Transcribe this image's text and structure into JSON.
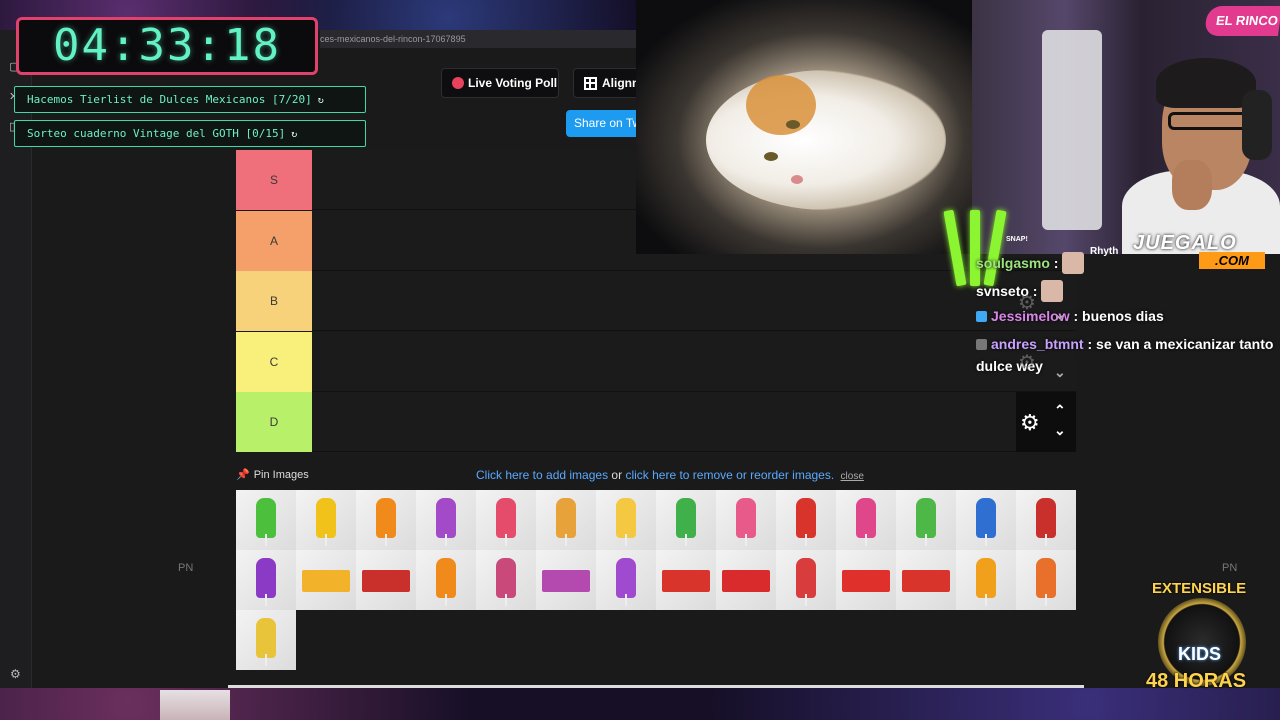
{
  "browser": {
    "url": "ces-mexicanos-del-rincon-17067895"
  },
  "timer": {
    "value": "04:33:18"
  },
  "goals": [
    {
      "label": "Hacemos Tierlist de Dulces Mexicanos [7/20]"
    },
    {
      "label": "Sorteo cuaderno Vintage del GOTH [0/15]"
    }
  ],
  "toolbar": {
    "poll_label": "Live Voting Poll",
    "align_label": "Alignm",
    "share_label": "Share on Tw"
  },
  "tiers": [
    {
      "label": "S",
      "color": "#ef6f7a"
    },
    {
      "label": "A",
      "color": "#f5a06b"
    },
    {
      "label": "B",
      "color": "#f7d27a"
    },
    {
      "label": "C",
      "color": "#f8f07a"
    },
    {
      "label": "D",
      "color": "#b8f06a"
    }
  ],
  "pin": {
    "label": "Pin Images",
    "link_add": "Click here to add images",
    "or": "or",
    "link_remove": "click here to remove or reorder images.",
    "close": "close"
  },
  "side_left": "PN",
  "side_right": "PN",
  "overlay": {
    "rincon_badge": "EL RINCO",
    "juegalo": "JUEGALO",
    "juegalo_com": ".COM",
    "snap": "SNAP!",
    "rhyth": "Rhyth"
  },
  "chat": [
    {
      "user": "soulgasmo",
      "sep": " :",
      "message": "",
      "user_color": "#9ee37d",
      "emote": true
    },
    {
      "user": "svnseto",
      "sep": " :",
      "message": "",
      "user_color": "#ffffff",
      "emote": true
    },
    {
      "user": "Jessimelow",
      "sep": " :",
      "message": " buenos dias",
      "user_color": "#d986e9",
      "emote": false
    },
    {
      "user": "andres_btmnt",
      "sep": " :",
      "message": " se van a mexicanizar tanto",
      "user_color": "#c7a2ff",
      "emote": false
    },
    {
      "user": "",
      "sep": "",
      "message": "dulce wey",
      "user_color": "#ffffff",
      "emote": false
    }
  ],
  "extensible": {
    "title": "EXTENSIBLE",
    "kids": "KIDS",
    "hours": "48 HORAS"
  },
  "candy_colors": [
    "#4cbf3c",
    "#f0c21a",
    "#f08a1a",
    "#a24ac8",
    "#e54b6a",
    "#e8a23a",
    "#f5c842",
    "#3fb04a",
    "#e85a8a",
    "#d9342b",
    "#e0478a",
    "#4db848",
    "#2f6fd1",
    "#c9302c",
    "#8a3ac4",
    "#f2b22a",
    "#c9302c",
    "#f08a1a",
    "#c94a7a",
    "#b44ab0",
    "#a04ad0",
    "#d9342b",
    "#d92b2b",
    "#d93c3c",
    "#e0302b",
    "#d9342b",
    "#f0a01a",
    "#e8702a",
    "#e8c43a"
  ]
}
